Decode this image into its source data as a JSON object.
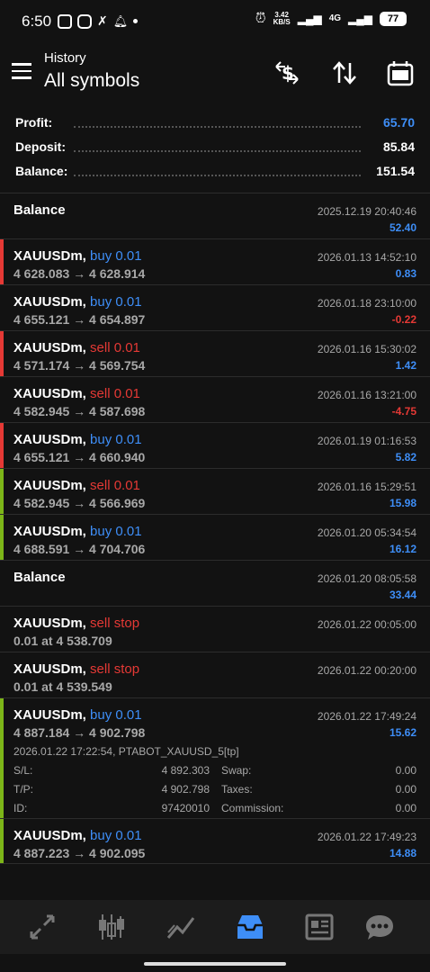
{
  "status_bar": {
    "time": "6:50",
    "speed_top": "3.42",
    "speed_bottom": "KB/S",
    "network": "4G",
    "battery": "77"
  },
  "header": {
    "subtitle": "History",
    "title": "All symbols"
  },
  "summary": {
    "profit_label": "Profit:",
    "profit_value": "65.70",
    "deposit_label": "Deposit:",
    "deposit_value": "85.84",
    "balance_label": "Balance:",
    "balance_value": "151.54"
  },
  "rows": [
    {
      "kind": "balance",
      "title": "Balance",
      "date": "2025.12.19 20:40:46",
      "amount": "52.40",
      "amount_color": "blue"
    },
    {
      "kind": "trade",
      "symbol": "XAUUSDm,",
      "side": "buy 0.01",
      "side_color": "blue",
      "prices": "4 628.083 → 4 628.914",
      "date": "2026.01.13 14:52:10",
      "amount": "0.83",
      "amount_color": "blue",
      "bar": "#e53935"
    },
    {
      "kind": "trade",
      "symbol": "XAUUSDm,",
      "side": "buy 0.01",
      "side_color": "blue",
      "prices": "4 655.121 → 4 654.897",
      "date": "2026.01.18 23:10:00",
      "amount": "-0.22",
      "amount_color": "red",
      "bar": ""
    },
    {
      "kind": "trade",
      "symbol": "XAUUSDm,",
      "side": "sell 0.01",
      "side_color": "red",
      "prices": "4 571.174 → 4 569.754",
      "date": "2026.01.16 15:30:02",
      "amount": "1.42",
      "amount_color": "blue",
      "bar": "#e53935"
    },
    {
      "kind": "trade",
      "symbol": "XAUUSDm,",
      "side": "sell 0.01",
      "side_color": "red",
      "prices": "4 582.945 → 4 587.698",
      "date": "2026.01.16 13:21:00",
      "amount": "-4.75",
      "amount_color": "red",
      "bar": ""
    },
    {
      "kind": "trade",
      "symbol": "XAUUSDm,",
      "side": "buy 0.01",
      "side_color": "blue",
      "prices": "4 655.121 → 4 660.940",
      "date": "2026.01.19 01:16:53",
      "amount": "5.82",
      "amount_color": "blue",
      "bar": "#e53935"
    },
    {
      "kind": "trade",
      "symbol": "XAUUSDm,",
      "side": "sell 0.01",
      "side_color": "red",
      "prices": "4 582.945 → 4 566.969",
      "date": "2026.01.16 15:29:51",
      "amount": "15.98",
      "amount_color": "blue",
      "bar": "#7cb518"
    },
    {
      "kind": "trade",
      "symbol": "XAUUSDm,",
      "side": "buy 0.01",
      "side_color": "blue",
      "prices": "4 688.591 → 4 704.706",
      "date": "2026.01.20 05:34:54",
      "amount": "16.12",
      "amount_color": "blue",
      "bar": "#7cb518"
    },
    {
      "kind": "balance",
      "title": "Balance",
      "date": "2026.01.20 08:05:58",
      "amount": "33.44",
      "amount_color": "blue"
    },
    {
      "kind": "order",
      "symbol": "XAUUSDm,",
      "side": "sell stop",
      "side_color": "red",
      "prices": "0.01 at 4 538.709",
      "date": "2026.01.22 00:05:00"
    },
    {
      "kind": "order",
      "symbol": "XAUUSDm,",
      "side": "sell stop",
      "side_color": "red",
      "prices": "0.01 at 4 539.549",
      "date": "2026.01.22 00:20:00"
    },
    {
      "kind": "expanded",
      "symbol": "XAUUSDm,",
      "side": "buy 0.01",
      "side_color": "blue",
      "prices": "4 887.184 → 4 902.798",
      "date": "2026.01.22 17:49:24",
      "amount": "15.62",
      "amount_color": "blue",
      "bar": "#7cb518",
      "comment": "2026.01.22 17:22:54, PTABOT_XAUUSD_5[tp]",
      "sl_label": "S/L:",
      "sl_value": "4 892.303",
      "swap_label": "Swap:",
      "swap_value": "0.00",
      "tp_label": "T/P:",
      "tp_value": "4 902.798",
      "taxes_label": "Taxes:",
      "taxes_value": "0.00",
      "id_label": "ID:",
      "id_value": "97420010",
      "commission_label": "Commission:",
      "commission_value": "0.00"
    },
    {
      "kind": "trade",
      "symbol": "XAUUSDm,",
      "side": "buy 0.01",
      "side_color": "blue",
      "prices": "4 887.223 → 4 902.095",
      "date": "2026.01.22 17:49:23",
      "amount": "14.88",
      "amount_color": "blue",
      "bar": "#7cb518"
    }
  ],
  "nav": [
    {
      "icon": "trade-arrows-icon",
      "active": false
    },
    {
      "icon": "candlestick-icon",
      "active": false
    },
    {
      "icon": "chart-line-icon",
      "active": false
    },
    {
      "icon": "history-inbox-icon",
      "active": true
    },
    {
      "icon": "news-icon",
      "active": false
    },
    {
      "icon": "chat-icon",
      "active": false
    }
  ],
  "colors": {
    "accent": "#3e8ef7",
    "loss": "#e53935",
    "profit_bar": "#7cb518",
    "background": "#121212"
  }
}
